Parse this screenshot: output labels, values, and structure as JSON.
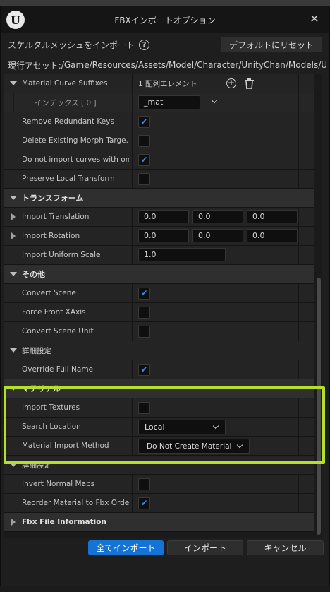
{
  "dialog": {
    "title": "FBXインポートオプション",
    "import_label": "スケルタルメッシュをインポート",
    "reset_button": "デフォルトにリセット",
    "path_label": "現行アセット: ",
    "path_value": "/Game/Resources/Assets/Model/Character/UnityChan/Models/U"
  },
  "rows": {
    "material_curve_suffixes": {
      "label": "Material Curve Suffixes",
      "value": "1 配列エレメント"
    },
    "index0": {
      "label": "インデックス [ 0 ]",
      "value": "_mat"
    },
    "remove_redundant_keys": {
      "label": "Remove Redundant Keys",
      "checked": true
    },
    "delete_existing_morph": {
      "label": "Delete Existing Morph Targe...",
      "checked": false
    },
    "do_not_import_curves": {
      "label": "Do not import curves with on...",
      "checked": true
    },
    "preserve_local_transform": {
      "label": "Preserve Local Transform",
      "checked": false
    },
    "transform_section": "トランスフォーム",
    "import_translation": {
      "label": "Import Translation",
      "x": "0.0",
      "y": "0.0",
      "z": "0.0"
    },
    "import_rotation": {
      "label": "Import Rotation",
      "x": "0.0",
      "y": "0.0",
      "z": "0.0"
    },
    "import_uniform_scale": {
      "label": "Import Uniform Scale",
      "value": "1.0"
    },
    "misc_section": "その他",
    "convert_scene": {
      "label": "Convert Scene",
      "checked": true
    },
    "force_front_xaxis": {
      "label": "Force Front XAxis",
      "checked": false
    },
    "convert_scene_unit": {
      "label": "Convert Scene Unit",
      "checked": false
    },
    "advanced_section_1": "詳細設定",
    "override_full_name": {
      "label": "Override Full Name",
      "checked": true
    },
    "material_section": "マテリアル",
    "import_textures": {
      "label": "Import Textures",
      "checked": false
    },
    "search_location": {
      "label": "Search Location",
      "value": "Local"
    },
    "material_import_method": {
      "label": "Material Import Method",
      "value": "Do Not Create Material"
    },
    "advanced_section_2": "詳細設定",
    "invert_normal_maps": {
      "label": "Invert Normal Maps",
      "checked": false
    },
    "reorder_material": {
      "label": "Reorder Material to Fbx Order",
      "checked": true
    },
    "fbx_file_information": "Fbx File Information"
  },
  "buttons": {
    "import_all": "全てインポート",
    "import": "インポート",
    "cancel": "キャンセル"
  },
  "icons": {
    "check": "✔",
    "close": "✕"
  },
  "colors": {
    "accent": "#1573d6",
    "check": "#3c8cf5",
    "highlight": "#b4e02a"
  }
}
